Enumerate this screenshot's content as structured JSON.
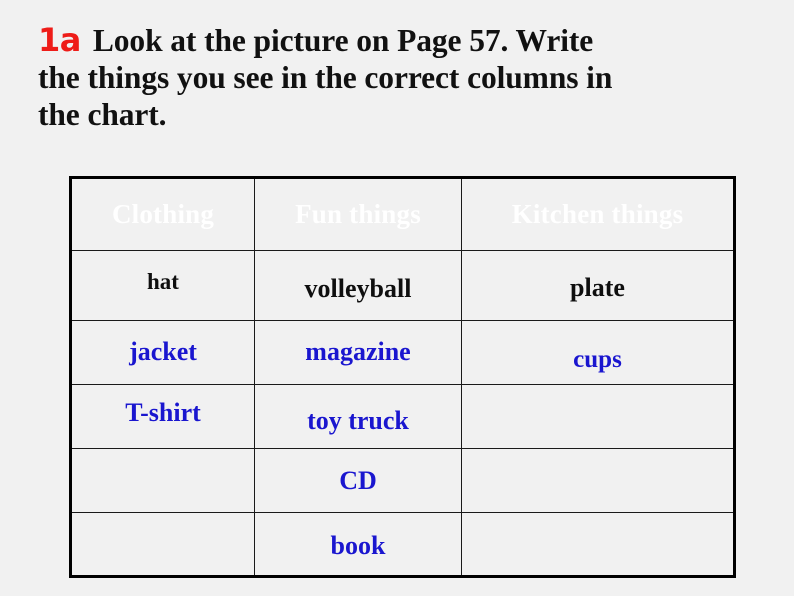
{
  "page": {
    "background_color": "#f1f1f1"
  },
  "instruction": {
    "tag": "1a",
    "tag_color": "#ee1c18",
    "line1": "Look at the picture on Page 57. Write",
    "line2": "the things you see in the correct columns in",
    "line3": "the chart."
  },
  "table": {
    "header_background": "#0d0dc4",
    "header_text_color": "#ffffff",
    "answer_color": "#1a16cf",
    "printed_color": "#0f0f0f",
    "columns": [
      "Clothing",
      "Fun things",
      "Kitchen things"
    ],
    "rows": [
      {
        "clothing": "hat",
        "fun": "volleyball",
        "kitchen": "plate"
      },
      {
        "clothing": "jacket",
        "fun": "magazine",
        "kitchen": "cups"
      },
      {
        "clothing": "T-shirt",
        "fun": "toy truck",
        "kitchen": ""
      },
      {
        "clothing": "",
        "fun": "CD",
        "kitchen": ""
      },
      {
        "clothing": "",
        "fun": "book",
        "kitchen": ""
      }
    ]
  }
}
